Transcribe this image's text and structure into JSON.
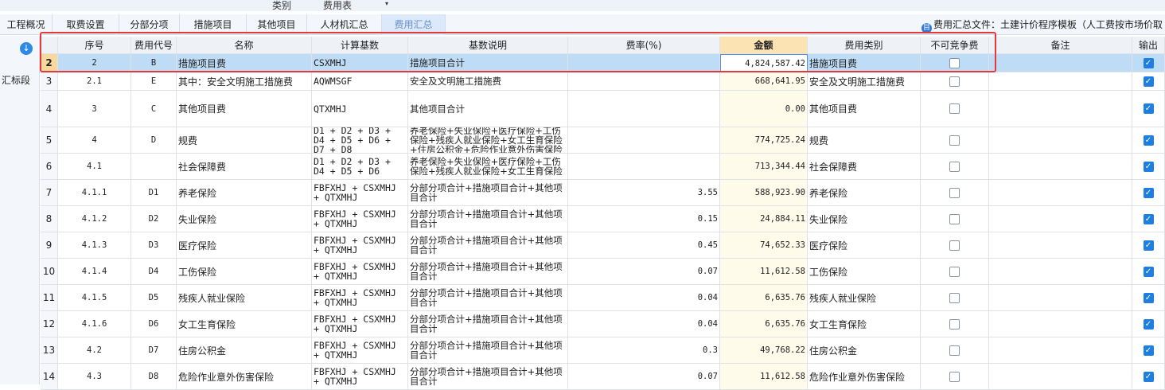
{
  "top_menu": [
    "类别",
    "费用表"
  ],
  "tabs": [
    "工程概况",
    "取费设置",
    "分部分项",
    "措施项目",
    "其他项目",
    "人材机汇总",
    "费用汇总"
  ],
  "active_tab": "费用汇总",
  "summary_file": "费用汇总文件：土建计价程序模板（人工费按市场价取",
  "side_label": "汇标段",
  "headers": [
    "",
    "序号",
    "费用代号",
    "名称",
    "计算基数",
    "基数说明",
    "费率(%)",
    "金额",
    "费用类别",
    "不可竞争费",
    "备注",
    "输出"
  ],
  "rows": [
    {
      "rn": "2",
      "seq": "2",
      "code": "B",
      "name": "措施项目费",
      "base": "CSXMHJ",
      "desc": "措施项目合计",
      "rate": "",
      "amount": "4,824,587.42",
      "category": "措施项目费",
      "selected": true
    },
    {
      "rn": "3",
      "seq": "2.1",
      "code": "E",
      "name": "其中：安全文明施工措施费",
      "base": "AQWMSGF",
      "desc": "安全及文明施工措施费",
      "rate": "",
      "amount": "668,641.95",
      "category": "安全及文明施工措施费"
    },
    {
      "rn": "4",
      "seq": "3",
      "code": "C",
      "name": "其他项目费",
      "base": "QTXMHJ",
      "desc": "其他项目合计",
      "rate": "",
      "amount": "0.00",
      "category": "其他项目费"
    },
    {
      "rn": "5",
      "seq": "4",
      "code": "D",
      "name": "规费",
      "base": "D1 + D2 + D3 + D4 + D5 + D6 + D7 + D8",
      "desc": "养老保险+失业保险+医疗保险+工伤保险+残疾人就业保险+女工生育保险+住房公积金+危险作业意外伤害保险",
      "rate": "",
      "amount": "774,725.24",
      "category": "规费"
    },
    {
      "rn": "6",
      "seq": "4.1",
      "code": "",
      "name": "社会保障费",
      "base": "D1 + D2 + D3 + D4 + D5 + D6",
      "desc": "养老保险+失业保险+医疗保险+工伤保险+残疾人就业保险+女工生育保险",
      "rate": "",
      "amount": "713,344.44",
      "category": "社会保障费"
    },
    {
      "rn": "7",
      "seq": "4.1.1",
      "code": "D1",
      "name": "养老保险",
      "base": "FBFXHJ + CSXMHJ + QTXMHJ",
      "desc": "分部分项合计+措施项目合计+其他项目合计",
      "rate": "3.55",
      "amount": "588,923.90",
      "category": "养老保险"
    },
    {
      "rn": "8",
      "seq": "4.1.2",
      "code": "D2",
      "name": "失业保险",
      "base": "FBFXHJ + CSXMHJ + QTXMHJ",
      "desc": "分部分项合计+措施项目合计+其他项目合计",
      "rate": "0.15",
      "amount": "24,884.11",
      "category": "失业保险"
    },
    {
      "rn": "9",
      "seq": "4.1.3",
      "code": "D3",
      "name": "医疗保险",
      "base": "FBFXHJ + CSXMHJ + QTXMHJ",
      "desc": "分部分项合计+措施项目合计+其他项目合计",
      "rate": "0.45",
      "amount": "74,652.33",
      "category": "医疗保险"
    },
    {
      "rn": "10",
      "seq": "4.1.4",
      "code": "D4",
      "name": "工伤保险",
      "base": "FBFXHJ + CSXMHJ + QTXMHJ",
      "desc": "分部分项合计+措施项目合计+其他项目合计",
      "rate": "0.07",
      "amount": "11,612.58",
      "category": "工伤保险"
    },
    {
      "rn": "11",
      "seq": "4.1.5",
      "code": "D5",
      "name": "残疾人就业保险",
      "base": "FBFXHJ + CSXMHJ + QTXMHJ",
      "desc": "分部分项合计+措施项目合计+其他项目合计",
      "rate": "0.04",
      "amount": "6,635.76",
      "category": "残疾人就业保险"
    },
    {
      "rn": "12",
      "seq": "4.1.6",
      "code": "D6",
      "name": "女工生育保险",
      "base": "FBFXHJ + CSXMHJ + QTXMHJ",
      "desc": "分部分项合计+措施项目合计+其他项目合计",
      "rate": "0.04",
      "amount": "6,635.76",
      "category": "女工生育保险"
    },
    {
      "rn": "13",
      "seq": "4.2",
      "code": "D7",
      "name": "住房公积金",
      "base": "FBFXHJ + CSXMHJ + QTXMHJ",
      "desc": "分部分项合计+措施项目合计+其他项目合计",
      "rate": "0.3",
      "amount": "49,768.22",
      "category": "住房公积金"
    },
    {
      "rn": "14",
      "seq": "4.3",
      "code": "D8",
      "name": "危险作业意外伤害保险",
      "base": "FBFXHJ + CSXMHJ + QTXMHJ",
      "desc": "分部分项合计+措施项目合计+其他项目合计",
      "rate": "0.07",
      "amount": "11,612.58",
      "category": "危险作业意外伤害保险"
    }
  ]
}
